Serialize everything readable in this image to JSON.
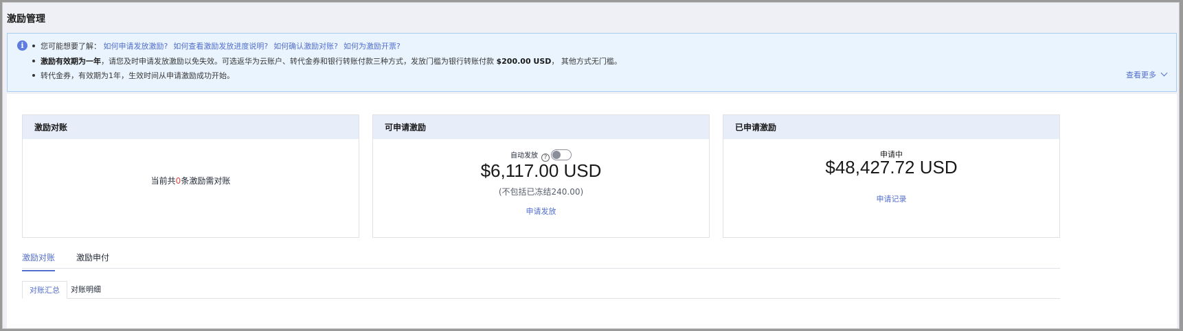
{
  "page": {
    "title": "激励管理"
  },
  "notice": {
    "intro": "您可能想要了解：",
    "links": [
      "如何申请发放激励?",
      "如何查看激励发放进度说明?",
      "如何确认激励对账?",
      "如何为激励开票?"
    ],
    "line2_bold": "激励有效期为一年",
    "line2_text1": "，请您及时申请发放激励以免失效。可选返华为云账户、转代金券和银行转账付款三种方式，发放门槛为银行转账付款 ",
    "line2_amount": "$200.00 USD",
    "line2_text2": "， 其他方式无门槛。",
    "line3": "转代金券，有效期为1年，生效时间从申请激励成功开始。",
    "more": "查看更多"
  },
  "cards": {
    "reconciliation": {
      "title": "激励对账",
      "text_before": "当前共",
      "count": "0",
      "text_after": "条激励需对账"
    },
    "available": {
      "title": "可申请激励",
      "auto_label": "自动发放",
      "help": "?",
      "amount": "$6,117.00 USD",
      "note": "(不包括已冻结240.00)",
      "action": "申请发放"
    },
    "applied": {
      "title": "已申请激励",
      "status": "申请中",
      "amount": "$48,427.72 USD",
      "action": "申请记录"
    }
  },
  "tabs": [
    "激励对账",
    "激励申付"
  ],
  "subtabs": [
    "对账汇总",
    "对账明细"
  ],
  "colors": {
    "accent": "#526ecc",
    "highlight": "#e54545",
    "card_header": "#e8edfa",
    "notice_bg": "#eaf4fe"
  }
}
